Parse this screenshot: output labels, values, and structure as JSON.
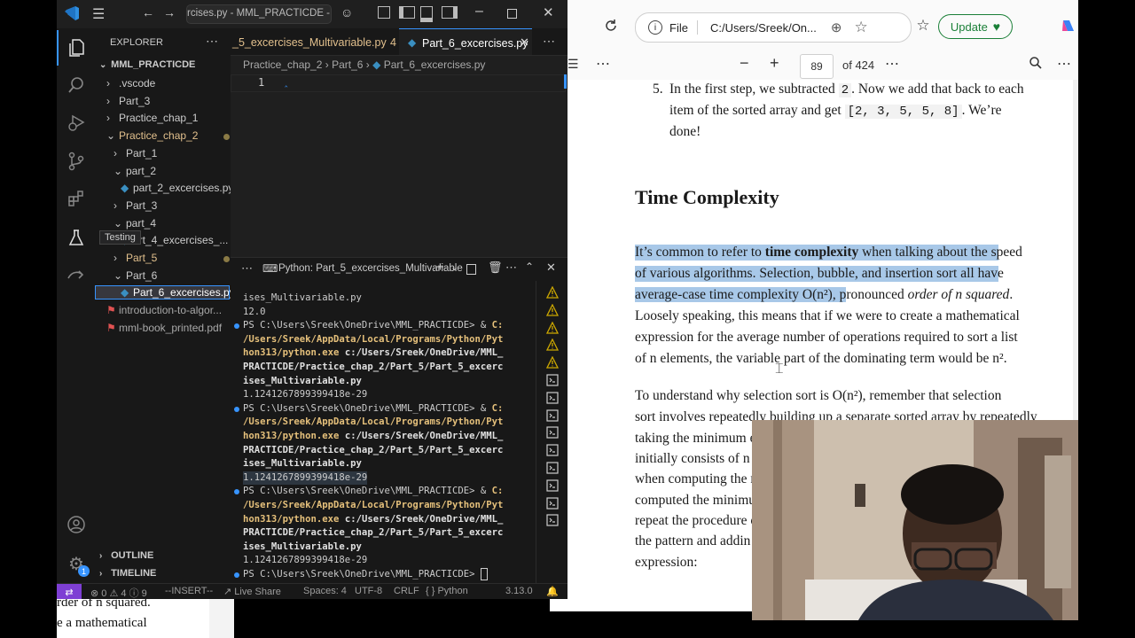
{
  "background_pdf": {
    "line1": "rder of n squared.",
    "line2": "e a mathematical"
  },
  "browser": {
    "file_label": "File",
    "address": "C:/Users/Sreek/On...",
    "update_label": "Update",
    "page_number": "89",
    "page_total": "of 424",
    "item5_number": "5.",
    "item5_line1": "In the first step, we subtracted",
    "item5_code1": "2",
    "item5_line1b": ". Now we add that back to each",
    "item5_line2": "item of the sorted array and get",
    "item5_code2": "[2, 3, 5, 5, 8]",
    "item5_line2b": ". We’re",
    "item5_line3": "done!",
    "heading": "Time Complexity",
    "p1_l1a": "It’s common to refer to",
    "p1_l1b": "time complexity",
    "p1_l1c": "when talking about the speed",
    "p1_l2": "of various algorithms. Selection, bubble, and insertion sort all have",
    "p1_l3a": "average-case time complexity O(n²), p",
    "p1_l3b": "ronounced",
    "p1_l3c": "order of n squared",
    "p1_l3d": ".",
    "p1_l4": "Loosely speaking, this means that if we were to create a mathematical",
    "p1_l5": "expression for the average number of operations required to sort a list",
    "p1_l6": "of n elements, the variable part of the dominating term would be n².",
    "p2_l1": "To understand why selection sort is O(n²), remember that selection",
    "p2_l2": "sort involves repeatedly building up a separate sorted array by repeatedly",
    "p2_l3": "taking the minimum el",
    "p2_l4": "initially consists of n",
    "p2_l5": "when computing the m",
    "p2_l6": "computed the minimu",
    "p2_l7": "repeat the procedure o",
    "p2_l8": "the pattern and addin",
    "p2_l9": "expression:"
  },
  "vscode": {
    "title": "rcises.py - MML_PRACTICDE - Visu",
    "explorer_title": "EXPLORER",
    "root_folder": "MML_PRACTICDE",
    "tree": [
      {
        "label": "vscode",
        "prefix": ".",
        "indent": 1,
        "kind": "folder-closed"
      },
      {
        "label": "Part_3",
        "indent": 1,
        "kind": "folder-closed"
      },
      {
        "label": "Practice_chap_1",
        "indent": 1,
        "kind": "folder-closed"
      },
      {
        "label": "Practice_chap_2",
        "indent": 1,
        "kind": "folder-open-modified"
      },
      {
        "label": "Part_1",
        "indent": 2,
        "kind": "folder-closed"
      },
      {
        "label": "part_2",
        "indent": 2,
        "kind": "folder-open"
      },
      {
        "label": "part_2_excercises.py",
        "indent": 3,
        "kind": "python"
      },
      {
        "label": "Part_3",
        "indent": 2,
        "kind": "folder-closed"
      },
      {
        "label": "part_4",
        "indent": 2,
        "kind": "folder-open"
      },
      {
        "label": "art_4_excercises_...",
        "indent": 3,
        "kind": "python"
      },
      {
        "label": "Part_5",
        "indent": 2,
        "kind": "folder-closed-modified"
      },
      {
        "label": "Part_6",
        "indent": 2,
        "kind": "folder-open"
      },
      {
        "label": "Part_6_excercises.py",
        "indent": 3,
        "kind": "python-selected"
      },
      {
        "label": "introduction-to-algor...",
        "indent": 1,
        "kind": "pdf"
      },
      {
        "label": "mml-book_printed.pdf",
        "indent": 1,
        "kind": "pdf"
      }
    ],
    "testing_tooltip": "Testing",
    "outline_label": "OUTLINE",
    "timeline_label": "TIMELINE",
    "tab_inactive": "_5_excercises_Multivariable.py",
    "tab_inactive_count": "4",
    "tab_active": "Part_6_excercises.py",
    "breadcrumb": [
      "Practice_chap_2",
      "Part_6",
      "Part_6_excercises.py"
    ],
    "line_number": "1",
    "terminal_title": "Python: Part_5_excercises_Multivariable",
    "terminal_lines": [
      "ises_Multivariable.py",
      "12.0",
      "PS C:\\Users\\Sreek\\OneDrive\\MML_PRACTICDE> & C:",
      "/Users/Sreek/AppData/Local/Programs/Python/Pyt",
      "hon313/python.exe c:/Users/Sreek/OneDrive/MML_",
      "PRACTICDE/Practice_chap_2/Part_5/Part_5_excerc",
      "ises_Multivariable.py",
      "1.1241267899399418e-29",
      "PS C:\\Users\\Sreek\\OneDrive\\MML_PRACTICDE> & C:",
      "/Users/Sreek/AppData/Local/Programs/Python/Pyt",
      "hon313/python.exe c:/Users/Sreek/OneDrive/MML_",
      "PRACTICDE/Practice_chap_2/Part_5/Part_5_excerc",
      "ises_Multivariable.py",
      "1.1241267899399418e-29",
      "PS C:\\Users\\Sreek\\OneDrive\\MML_PRACTICDE> & C:",
      "/Users/Sreek/AppData/Local/Programs/Python/Pyt",
      "hon313/python.exe c:/Users/Sreek/OneDrive/MML_",
      "PRACTICDE/Practice_chap_2/Part_5/Part_5_excerc",
      "ises_Multivariable.py",
      "1.1241267899399418e-29",
      "PS C:\\Users\\Sreek\\OneDrive\\MML_PRACTICDE> "
    ],
    "status": {
      "errors": "0",
      "warnings": "4",
      "info": "9",
      "mode": "--INSERT--",
      "live_share": "Live Share",
      "spaces": "Spaces: 4",
      "encoding": "UTF-8",
      "eol": "CRLF",
      "language": "Python",
      "version": "3.13.0"
    },
    "accounts_badge": "1"
  },
  "colors": {
    "accent": "#3794ff",
    "highlight": "#a8c8e8",
    "modified": "#e2c08d"
  }
}
